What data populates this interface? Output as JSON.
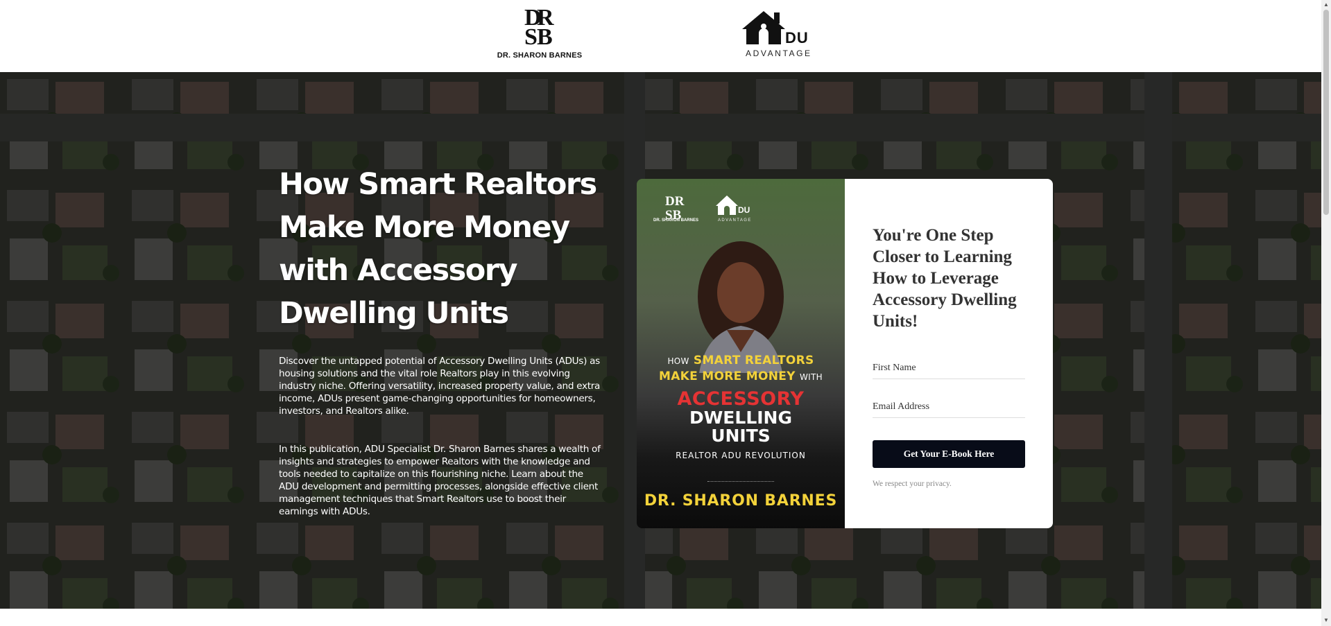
{
  "header": {
    "brand_left": {
      "caption": "DR. SHARON BARNES",
      "icon": "drsb-monogram-logo"
    },
    "brand_right": {
      "letters": "DU",
      "caption": "ADVANTAGE",
      "icon": "house-logo"
    }
  },
  "hero": {
    "headline": "How Smart Realtors Make More Money with Accessory Dwelling Units",
    "paragraph1": "Discover the untapped potential of Accessory Dwelling Units (ADUs) as housing solutions and the vital role Realtors play in this evolving industry niche. Offering versatility, increased property value, and extra income, ADUs present game-changing opportunities for homeowners, investors, and Realtors alike.",
    "paragraph2": "In this publication, ADU Specialist Dr. Sharon Barnes shares a wealth of insights and strategies to empower Realtors with the knowledge and tools needed to capitalize on this flourishing niche. Learn about the ADU development and permitting processes, alongside effective client management techniques that Smart Realtors use to boost their earnings with ADUs."
  },
  "book_cover": {
    "brand_caption": "DR. SHARON BARNES",
    "brand_letters": "DU",
    "brand_sub": "ADVANTAGE",
    "line1_small": "HOW",
    "line1": "SMART REALTORS",
    "line2": "MAKE MORE MONEY",
    "line2_small": "WITH",
    "line3": "ACCESSORY",
    "line4": "DWELLING",
    "line5": "UNITS",
    "subtitle": "REALTOR ADU REVOLUTION",
    "author": "DR. SHARON BARNES"
  },
  "form": {
    "title": "You're One Step Closer to Learning How to Leverage Accessory Dwelling Units!",
    "first_name_placeholder": "First Name",
    "email_placeholder": "Email Address",
    "submit_label": "Get Your E-Book Here",
    "privacy_text": "We respect your privacy."
  },
  "colors": {
    "button_bg": "#080c18",
    "cover_yellow": "#f3d23a",
    "cover_red": "#e53334"
  }
}
